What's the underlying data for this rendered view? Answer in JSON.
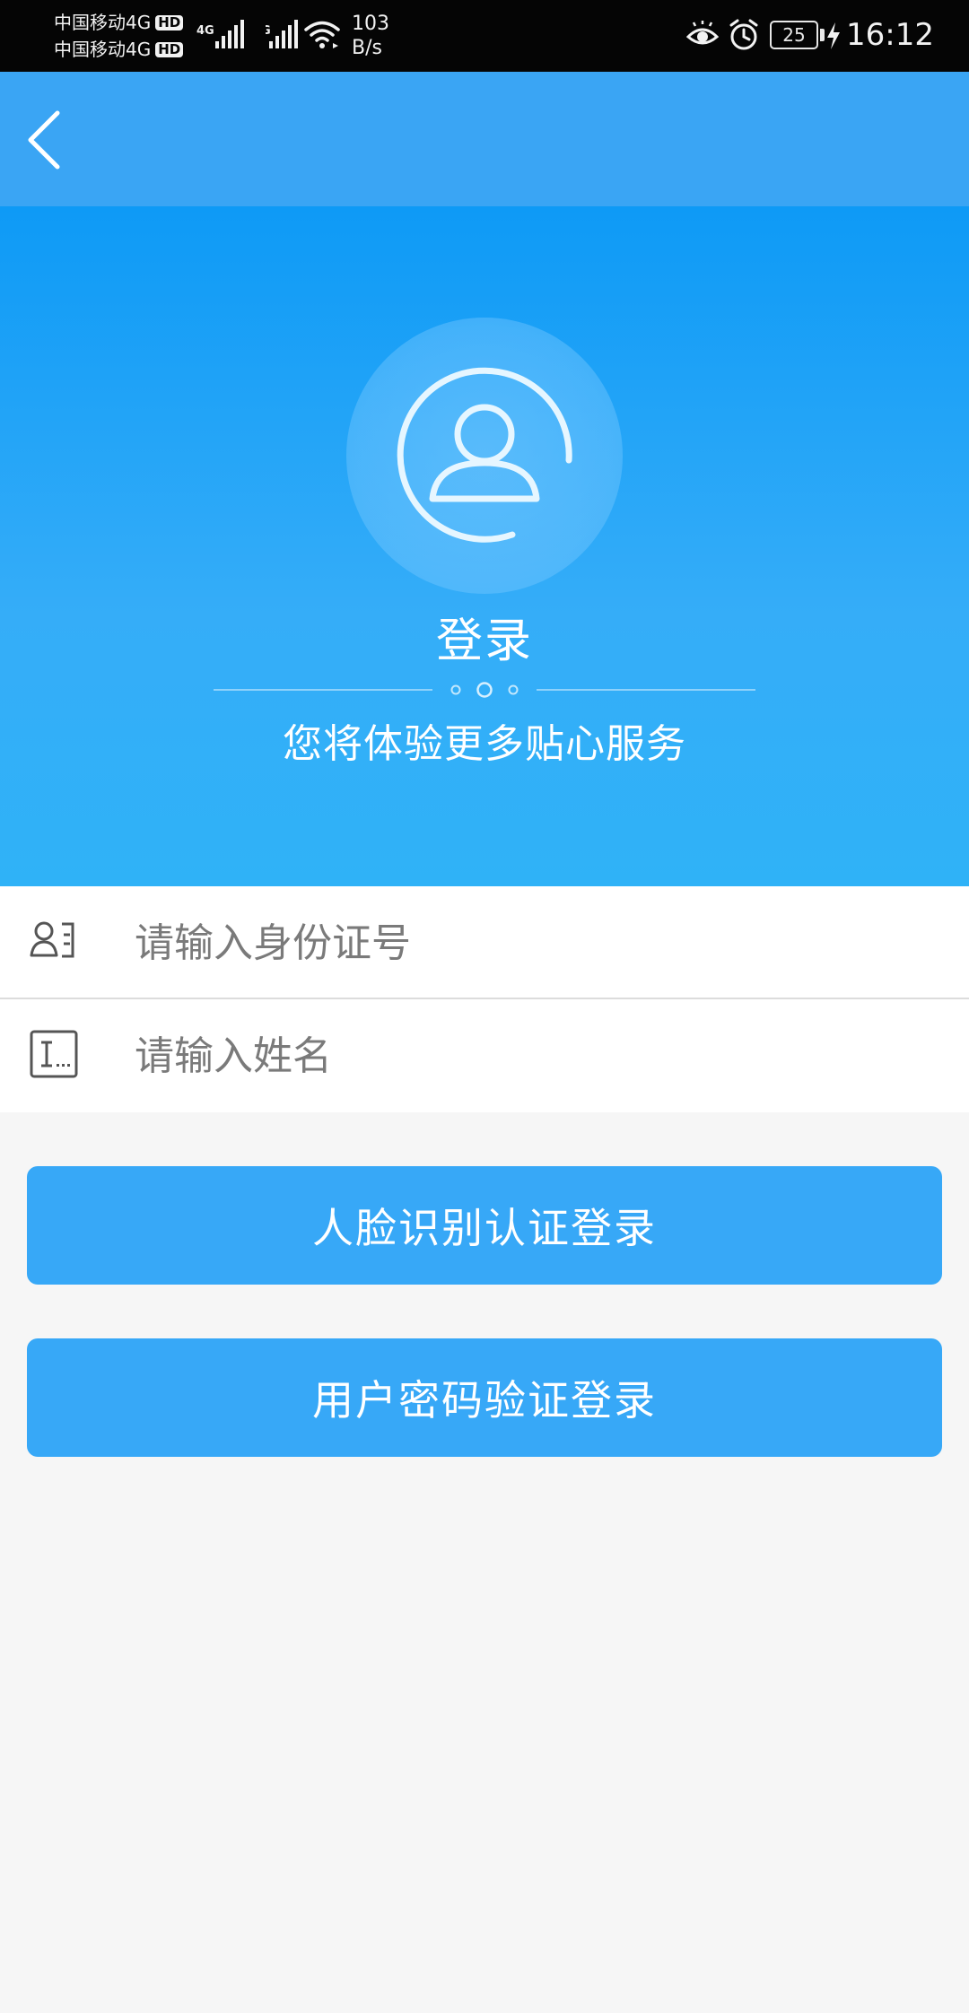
{
  "status_bar": {
    "carrier_line_1": "中国移动4G",
    "carrier_line_2": "中国移动4G",
    "hd_badge": "HD",
    "network_type": "4G",
    "speed_value": "103",
    "speed_unit": "B/s",
    "battery_level": "25",
    "time": "16:12",
    "icons": [
      "signal-icon",
      "wifi-icon",
      "eye-comfort-icon",
      "alarm-icon",
      "battery-icon",
      "charging-icon"
    ]
  },
  "header": {
    "back_icon": "chevron-left-icon"
  },
  "hero": {
    "avatar_icon": "user-circle-icon",
    "title": "登录",
    "subtitle": "您将体验更多贴心服务"
  },
  "form": {
    "id_number": {
      "icon": "id-card-icon",
      "placeholder": "请输入身份证号",
      "value": ""
    },
    "name": {
      "icon": "name-field-icon",
      "placeholder": "请输入姓名",
      "value": ""
    }
  },
  "actions": {
    "face_login_label": "人脸识别认证登录",
    "password_login_label": "用户密码验证登录"
  },
  "colors": {
    "header_bg": "#3aa5f4",
    "hero_gradient_top": "#0e9af6",
    "hero_gradient_bottom": "#2fb2f7",
    "button_bg": "#37a8f7",
    "page_bg": "#f6f6f6"
  }
}
